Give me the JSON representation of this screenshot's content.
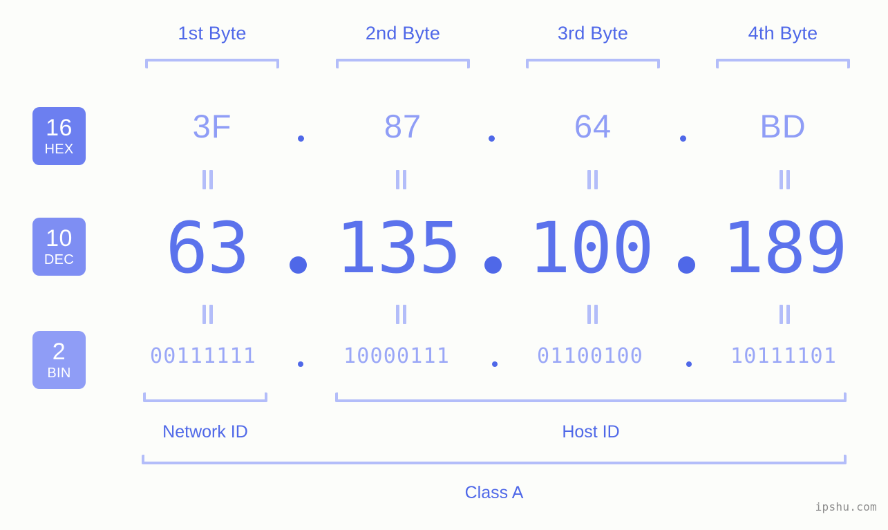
{
  "background_color": "#fcfdfa",
  "accent_color": "#4f68e8",
  "bracket_color": "#b3bdf9",
  "headers": {
    "bytes": [
      {
        "label": "1st Byte"
      },
      {
        "label": "2nd Byte"
      },
      {
        "label": "3rd Byte"
      },
      {
        "label": "4th Byte"
      }
    ]
  },
  "rows": [
    {
      "id": "hex",
      "badge_base": "16",
      "badge_name": "HEX",
      "badge_color": "#6c7ff0",
      "values": [
        "3F",
        "87",
        "64",
        "BD"
      ],
      "separator": "."
    },
    {
      "id": "dec",
      "badge_base": "10",
      "badge_name": "DEC",
      "badge_color": "#7e8ef3",
      "values": [
        "63",
        "135",
        "100",
        "189"
      ],
      "separator": "."
    },
    {
      "id": "bin",
      "badge_base": "2",
      "badge_name": "BIN",
      "badge_color": "#8f9df6",
      "values": [
        "00111111",
        "10000111",
        "01100100",
        "10111101"
      ],
      "separator": "."
    }
  ],
  "equality_marks": {
    "glyph": "=",
    "count_per_gap": 4
  },
  "sections": {
    "network_id": "Network ID",
    "host_id": "Host ID",
    "class": "Class A"
  },
  "watermark": "ipshu.com"
}
